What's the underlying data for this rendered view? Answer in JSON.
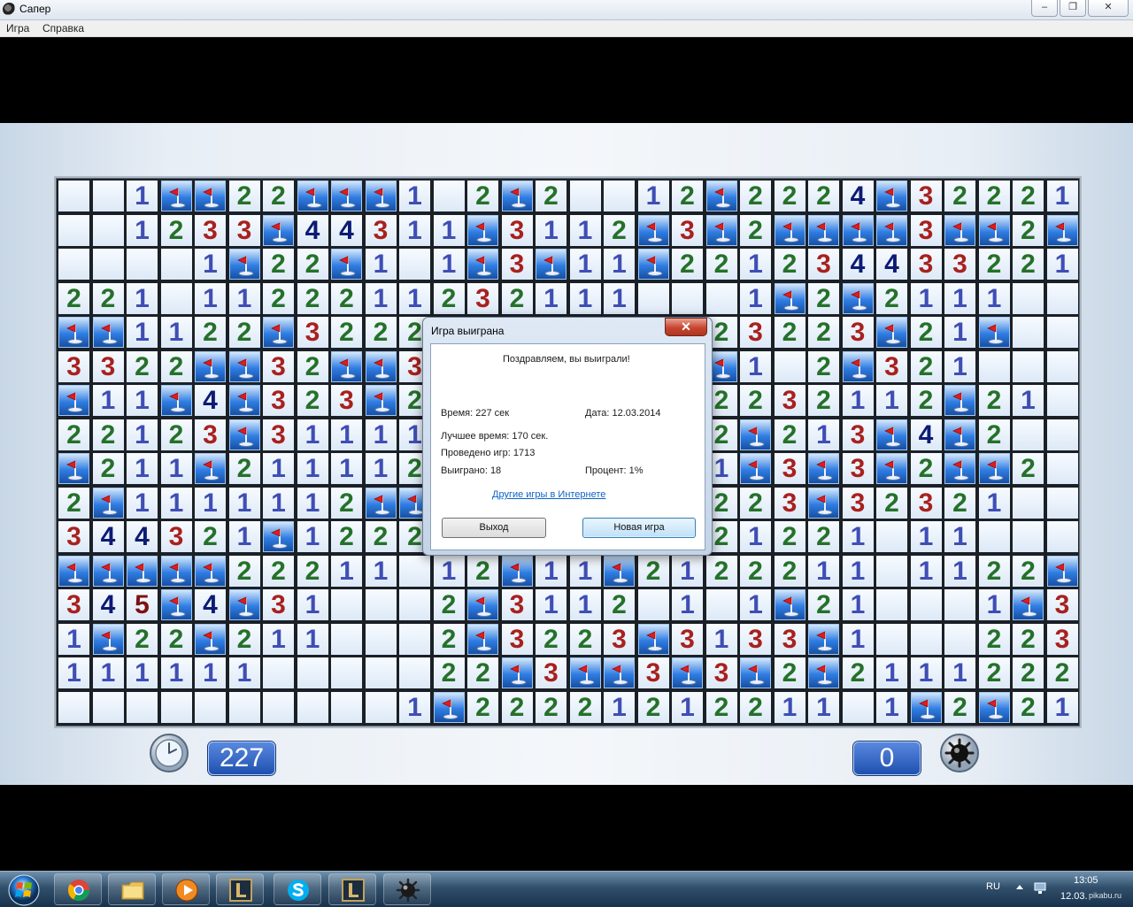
{
  "window": {
    "title": "Сапер",
    "minimize": "–",
    "restore": "❐",
    "close": "✕"
  },
  "menu": [
    "Игра",
    "Справка"
  ],
  "board": {
    "rows": 16,
    "cols": 30,
    "grid": [
      "OO1FF22FFF1O2F2OO12F2224F3222 1",
      "OO1233F44311F3112F3F2FFFF3FF2F",
      "OOOO1F22F1O1F3F11F22123443322 1",
      "221O1122211232111OOO1F2F2111",
      "FF1122F3222O11O2F1123223F21F",
      "3322FF32FF3O1F21O2FF1O2F321",
      "F11F4F323F2OO2F211F2232112F21",
      "22123F311111F3OO2212F213F4F2",
      "F211F2111121O1O1F2F1F3F3F2FF2",
      "2F1111112FF2OF2O1O2223F3232 1",
      "344321F122233F2111F21221O11",
      "FFFFF22211O12F11F2122211O1122F",
      "345F4F31OOO2F3112O1O1F21OOO1F32",
      "1F22F211OOO2F3223F3133F1OOO223F",
      "111111OOOOO22F3FF3F3F2F2111222F21",
      "OOOOOOOOOO1F22221212211O1F2F21O"
    ]
  },
  "hud": {
    "time": "227",
    "mines": "0"
  },
  "dialog": {
    "title": "Игра выиграна",
    "close_label": "✕",
    "congrats": "Поздравляем, вы выиграли!",
    "time": "Время: 227 сек",
    "date": "Дата: 12.03.2014",
    "best_time": "Лучшее время: 170 сек.",
    "games_played": "Проведено игр: 1713",
    "games_won": "Выиграно: 18",
    "percent": "Процент: 1%",
    "online_link": "Другие игры в Интернете",
    "exit_button": "Выход",
    "new_game_button": "Новая игра"
  },
  "taskbar": {
    "apps": [
      "start",
      "chrome",
      "explorer",
      "media-player",
      "league-of-legends",
      "skype",
      "league-of-legends",
      "minesweeper"
    ],
    "lang": "RU",
    "time": "13:05",
    "date": "12.03.",
    "watermark": "pikabu.ru"
  },
  "colors": {
    "n1": "#3f4eb4",
    "n2": "#25712a",
    "n3": "#a8211e",
    "n4": "#0c1b74",
    "n5": "#7d1212",
    "flag": "#e21b1b",
    "tile_blue": "#2f7de3"
  }
}
